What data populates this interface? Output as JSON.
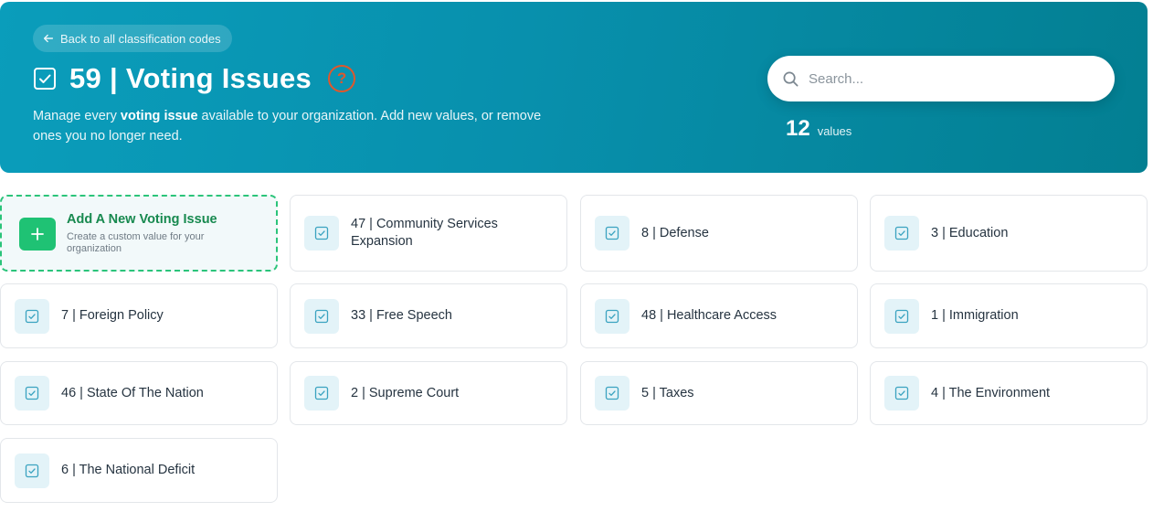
{
  "header": {
    "back_label": "Back to all classification codes",
    "title": "59 | Voting Issues",
    "help_icon": "question-circle-icon",
    "desc_pre": "Manage every ",
    "desc_bold": "voting issue",
    "desc_post": " available to your organization. Add new values, or remove ones you no longer need."
  },
  "search": {
    "placeholder": "Search..."
  },
  "count": {
    "number": "12",
    "label": "values"
  },
  "add_card": {
    "title": "Add A New Voting Issue",
    "subtitle": "Create a custom value for your organization"
  },
  "items": [
    {
      "label": "47 | Community Services Expansion"
    },
    {
      "label": "8 | Defense"
    },
    {
      "label": "3 | Education"
    },
    {
      "label": "7 | Foreign Policy"
    },
    {
      "label": "33 | Free Speech"
    },
    {
      "label": "48 | Healthcare Access"
    },
    {
      "label": "1 | Immigration"
    },
    {
      "label": "46 | State Of The Nation"
    },
    {
      "label": "2 | Supreme Court"
    },
    {
      "label": "5 | Taxes"
    },
    {
      "label": "4 | The Environment"
    },
    {
      "label": "6 | The National Deficit"
    }
  ],
  "colors": {
    "accent": "#0890ad",
    "add_green": "#1fc274",
    "help_orange": "#e0572c"
  }
}
